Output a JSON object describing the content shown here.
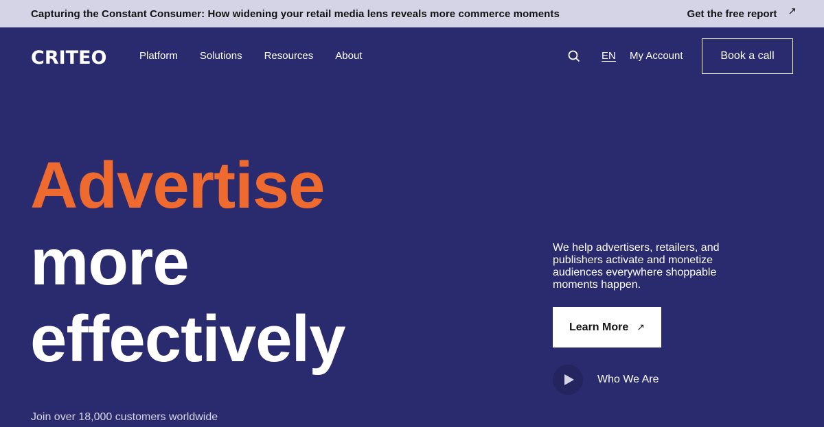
{
  "banner": {
    "text": "Capturing the Constant Consumer: How widening your retail media lens reveals more commerce moments",
    "link_label": "Get the free report",
    "link_icon": "arrow-up-right-icon"
  },
  "nav": {
    "logo": "CRITEO",
    "menu": [
      {
        "label": "Platform"
      },
      {
        "label": "Solutions"
      },
      {
        "label": "Resources"
      },
      {
        "label": "About"
      }
    ],
    "search_icon": "search-icon",
    "language": "EN",
    "account_label": "My Account",
    "cta_label": "Book a call"
  },
  "hero": {
    "headline": [
      "Advertise",
      "more",
      "effectively"
    ],
    "description": "We help advertisers, retailers, and publishers activate and monetize audiences everywhere shoppable moments happen.",
    "primary_cta": "Learn More",
    "primary_cta_icon": "arrow-up-right-icon",
    "video_label": "Who We Are",
    "video_icon": "play-icon",
    "social_proof": "Join over 18,000 customers worldwide"
  },
  "colors": {
    "background": "#2a2a6f",
    "banner": "#d4d4e6",
    "accent": "#ee6a2e"
  }
}
